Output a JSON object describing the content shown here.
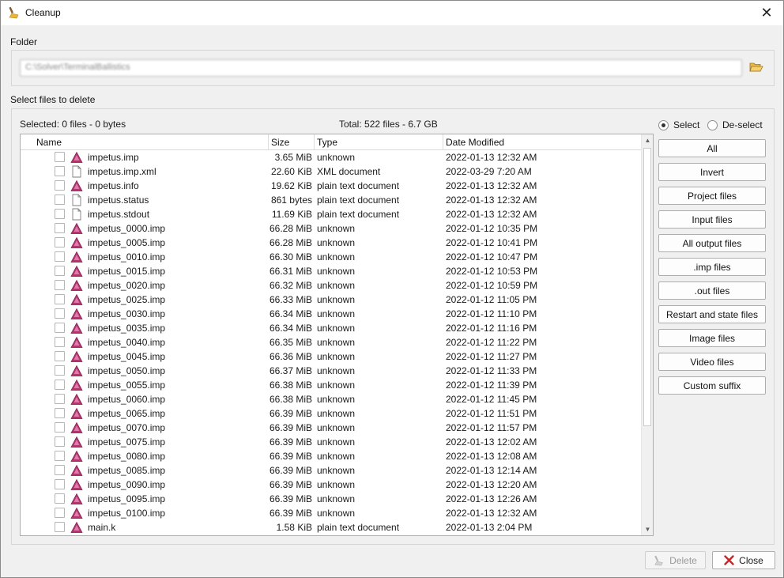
{
  "window": {
    "title": "Cleanup",
    "close_glyph": "✕"
  },
  "folder": {
    "label": "Folder",
    "path": "C:\\Solver\\TerminalBallistics"
  },
  "files": {
    "label": "Select files to delete",
    "selected_summary": "Selected: 0 files - 0 bytes",
    "total_summary": "Total: 522 files - 6.7 GB",
    "columns": [
      "Name",
      "Size",
      "Type",
      "Date Modified"
    ],
    "rows": [
      {
        "name": "impetus.imp",
        "size": "3.65 MiB",
        "type": "unknown",
        "date": "2022-01-13 12:32 AM",
        "icon": "impetus-triangle-icon"
      },
      {
        "name": "impetus.imp.xml",
        "size": "22.60 KiB",
        "type": "XML document",
        "date": "2022-03-29 7:20 AM",
        "icon": "document-icon"
      },
      {
        "name": "impetus.info",
        "size": "19.62 KiB",
        "type": "plain text document",
        "date": "2022-01-13 12:32 AM",
        "icon": "impetus-triangle-icon"
      },
      {
        "name": "impetus.status",
        "size": "861 bytes",
        "type": "plain text document",
        "date": "2022-01-13 12:32 AM",
        "icon": "document-icon"
      },
      {
        "name": "impetus.stdout",
        "size": "11.69 KiB",
        "type": "plain text document",
        "date": "2022-01-13 12:32 AM",
        "icon": "document-icon"
      },
      {
        "name": "impetus_0000.imp",
        "size": "66.28 MiB",
        "type": "unknown",
        "date": "2022-01-12 10:35 PM",
        "icon": "impetus-triangle-icon"
      },
      {
        "name": "impetus_0005.imp",
        "size": "66.28 MiB",
        "type": "unknown",
        "date": "2022-01-12 10:41 PM",
        "icon": "impetus-triangle-icon"
      },
      {
        "name": "impetus_0010.imp",
        "size": "66.30 MiB",
        "type": "unknown",
        "date": "2022-01-12 10:47 PM",
        "icon": "impetus-triangle-icon"
      },
      {
        "name": "impetus_0015.imp",
        "size": "66.31 MiB",
        "type": "unknown",
        "date": "2022-01-12 10:53 PM",
        "icon": "impetus-triangle-icon"
      },
      {
        "name": "impetus_0020.imp",
        "size": "66.32 MiB",
        "type": "unknown",
        "date": "2022-01-12 10:59 PM",
        "icon": "impetus-triangle-icon"
      },
      {
        "name": "impetus_0025.imp",
        "size": "66.33 MiB",
        "type": "unknown",
        "date": "2022-01-12 11:05 PM",
        "icon": "impetus-triangle-icon"
      },
      {
        "name": "impetus_0030.imp",
        "size": "66.34 MiB",
        "type": "unknown",
        "date": "2022-01-12 11:10 PM",
        "icon": "impetus-triangle-icon"
      },
      {
        "name": "impetus_0035.imp",
        "size": "66.34 MiB",
        "type": "unknown",
        "date": "2022-01-12 11:16 PM",
        "icon": "impetus-triangle-icon"
      },
      {
        "name": "impetus_0040.imp",
        "size": "66.35 MiB",
        "type": "unknown",
        "date": "2022-01-12 11:22 PM",
        "icon": "impetus-triangle-icon"
      },
      {
        "name": "impetus_0045.imp",
        "size": "66.36 MiB",
        "type": "unknown",
        "date": "2022-01-12 11:27 PM",
        "icon": "impetus-triangle-icon"
      },
      {
        "name": "impetus_0050.imp",
        "size": "66.37 MiB",
        "type": "unknown",
        "date": "2022-01-12 11:33 PM",
        "icon": "impetus-triangle-icon"
      },
      {
        "name": "impetus_0055.imp",
        "size": "66.38 MiB",
        "type": "unknown",
        "date": "2022-01-12 11:39 PM",
        "icon": "impetus-triangle-icon"
      },
      {
        "name": "impetus_0060.imp",
        "size": "66.38 MiB",
        "type": "unknown",
        "date": "2022-01-12 11:45 PM",
        "icon": "impetus-triangle-icon"
      },
      {
        "name": "impetus_0065.imp",
        "size": "66.39 MiB",
        "type": "unknown",
        "date": "2022-01-12 11:51 PM",
        "icon": "impetus-triangle-icon"
      },
      {
        "name": "impetus_0070.imp",
        "size": "66.39 MiB",
        "type": "unknown",
        "date": "2022-01-12 11:57 PM",
        "icon": "impetus-triangle-icon"
      },
      {
        "name": "impetus_0075.imp",
        "size": "66.39 MiB",
        "type": "unknown",
        "date": "2022-01-13 12:02 AM",
        "icon": "impetus-triangle-icon"
      },
      {
        "name": "impetus_0080.imp",
        "size": "66.39 MiB",
        "type": "unknown",
        "date": "2022-01-13 12:08 AM",
        "icon": "impetus-triangle-icon"
      },
      {
        "name": "impetus_0085.imp",
        "size": "66.39 MiB",
        "type": "unknown",
        "date": "2022-01-13 12:14 AM",
        "icon": "impetus-triangle-icon"
      },
      {
        "name": "impetus_0090.imp",
        "size": "66.39 MiB",
        "type": "unknown",
        "date": "2022-01-13 12:20 AM",
        "icon": "impetus-triangle-icon"
      },
      {
        "name": "impetus_0095.imp",
        "size": "66.39 MiB",
        "type": "unknown",
        "date": "2022-01-13 12:26 AM",
        "icon": "impetus-triangle-icon"
      },
      {
        "name": "impetus_0100.imp",
        "size": "66.39 MiB",
        "type": "unknown",
        "date": "2022-01-13 12:32 AM",
        "icon": "impetus-triangle-icon"
      },
      {
        "name": "main.k",
        "size": "1.58 KiB",
        "type": "plain text document",
        "date": "2022-01-13 2:04 PM",
        "icon": "impetus-triangle-icon"
      }
    ]
  },
  "selection": {
    "mode_options": [
      "Select",
      "De-select"
    ],
    "mode_selected": "Select",
    "buttons": [
      "All",
      "Invert",
      "Project files",
      "Input files",
      "All output files",
      ".imp files",
      ".out files",
      "Restart and state files",
      "Image files",
      "Video files",
      "Custom suffix"
    ]
  },
  "footer": {
    "delete_label": "Delete",
    "close_label": "Close"
  },
  "colors": {
    "impetus_icon": "#b5336f",
    "close_icon": "#d42020"
  }
}
